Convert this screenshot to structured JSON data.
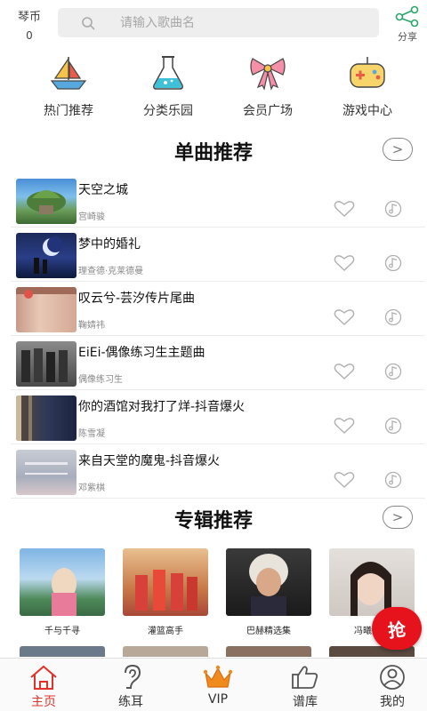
{
  "header": {
    "coins_label": "琴币",
    "coins_value": "0",
    "search_placeholder": "请输入歌曲名",
    "share_label": "分享"
  },
  "categories": [
    {
      "label": "热门推荐",
      "icon": "sailboat-icon"
    },
    {
      "label": "分类乐园",
      "icon": "flask-icon"
    },
    {
      "label": "会员广场",
      "icon": "bow-icon"
    },
    {
      "label": "游戏中心",
      "icon": "gamepad-icon"
    }
  ],
  "songs_section": {
    "title": "单曲推荐"
  },
  "songs": [
    {
      "title": "天空之城",
      "artist": "宫崎骏"
    },
    {
      "title": "梦中的婚礼",
      "artist": "理查德·克莱德曼"
    },
    {
      "title": "叹云兮-芸汐传片尾曲",
      "artist": "鞠婧祎"
    },
    {
      "title": "EiEi-偶像练习生主题曲",
      "artist": "偶像练习生"
    },
    {
      "title": "你的酒馆对我打了烊-抖音爆火",
      "artist": "陈雪凝"
    },
    {
      "title": "来自天堂的魔鬼-抖音爆火",
      "artist": "邓紫棋"
    }
  ],
  "albums_section": {
    "title": "专辑推荐"
  },
  "albums": [
    {
      "name": "千与千寻"
    },
    {
      "name": "灌篮高手"
    },
    {
      "name": "巴赫精选集"
    },
    {
      "name": "冯曦妤专"
    }
  ],
  "grab_label": "抢",
  "nav": [
    {
      "label": "主页",
      "icon": "home-icon",
      "active": true
    },
    {
      "label": "练耳",
      "icon": "ear-icon"
    },
    {
      "label": "VIP",
      "icon": "crown-icon"
    },
    {
      "label": "谱库",
      "icon": "thumbs-up-icon"
    },
    {
      "label": "我的",
      "icon": "user-icon"
    }
  ],
  "colors": {
    "accent": "#e0322a",
    "vip": "#f08a1c",
    "grab": "#e6121c"
  }
}
